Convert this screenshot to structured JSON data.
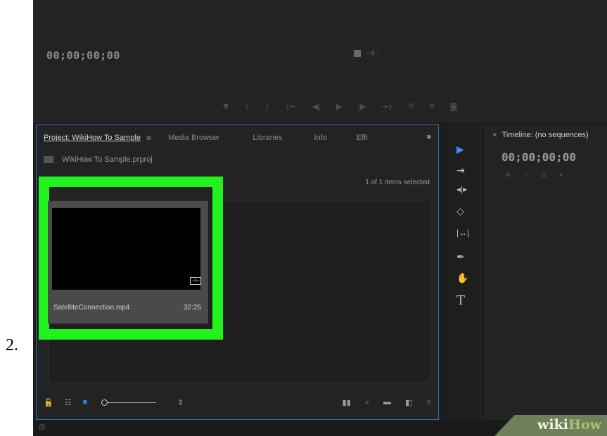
{
  "step_number": "2.",
  "monitor": {
    "timecode": "00;00;00;00",
    "center_glyph": "⊣⊢",
    "transport": [
      "▼",
      "{",
      "}",
      "{⇤",
      "◀|",
      "▶",
      "|▶",
      "⇥}",
      "⧉",
      "⧈",
      "◙"
    ]
  },
  "project_panel": {
    "tabs": [
      {
        "label": "Project: WikiHow To Sample",
        "active": true
      },
      {
        "label": "Media Browser",
        "active": false
      },
      {
        "label": "Libraries",
        "active": false
      },
      {
        "label": "Info",
        "active": false
      },
      {
        "label": "Effi",
        "active": false
      }
    ],
    "menu_glyph": "≡",
    "more_glyph": "»",
    "project_file": "WikiHow To Sample.prproj",
    "items_selected": "1 of 1 items selected",
    "clip": {
      "name": "SatelliteConnection.mp4",
      "duration": "32:25",
      "badge": "⊣⊢"
    },
    "highlight_color": "#21f11c",
    "footer_icons": [
      "lock-icon",
      "list-view-icon",
      "icon-view-icon",
      "zoom-slider",
      "sort-icon",
      "automate-icon",
      "find-icon",
      "new-bin-icon",
      "new-item-icon",
      "trash-icon"
    ]
  },
  "tools": [
    "▶",
    "⇥",
    "◂|▸",
    "◇",
    "|↔|",
    "✒",
    "✋",
    "T"
  ],
  "timeline": {
    "title": "Timeline: (no sequences)",
    "close_glyph": "×",
    "timecode": "00;00;00;00"
  },
  "watermark": {
    "part1": "wiki",
    "part2": "How"
  },
  "colors": {
    "accent_blue": "#2e6fb0",
    "highlight_green": "#21f11c",
    "panel_bg": "#232323"
  }
}
